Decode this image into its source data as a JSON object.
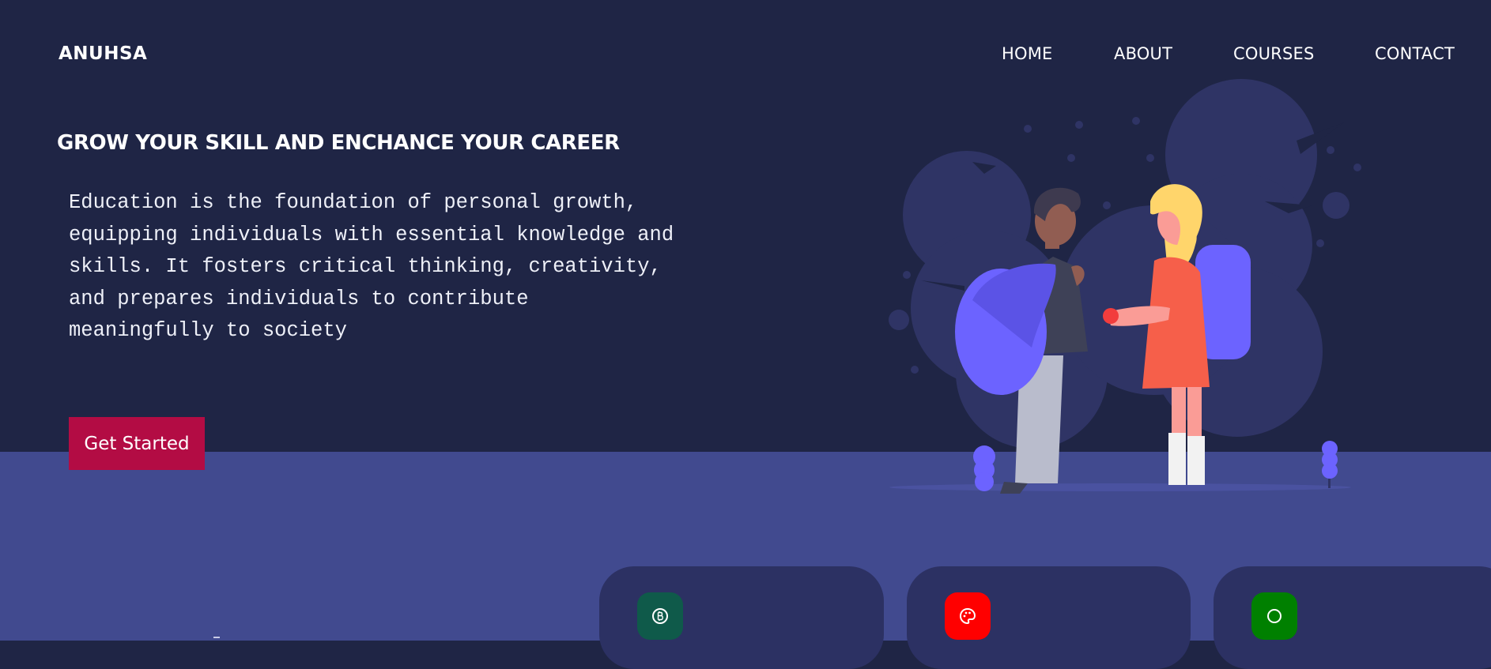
{
  "brand": {
    "logo_text": "ANUHSA"
  },
  "nav": {
    "items": [
      "HOME",
      "ABOUT",
      "COURSES",
      "CONTACT"
    ]
  },
  "hero": {
    "headline": "GROW YOUR SKILL AND ENCHANCE YOUR CAREER",
    "description": "Education is the foundation of personal growth, equipping individuals with essential knowledge and skills. It fosters critical thinking, creativity, and prepares individuals to contribute meaningfully to society",
    "cta_label": "Get Started"
  },
  "cards": [
    {
      "icon": "bitcoin-icon",
      "color": "#0f5a4a"
    },
    {
      "icon": "palette-icon",
      "color": "#ff0000"
    },
    {
      "icon": "circle-icon",
      "color": "#008000"
    }
  ],
  "colors": {
    "hero_background": "#1f2545",
    "lower_background": "#414a8f",
    "card_background": "#2c3163",
    "accent": "#b30c44",
    "illustration_primary": "#6c63ff"
  }
}
